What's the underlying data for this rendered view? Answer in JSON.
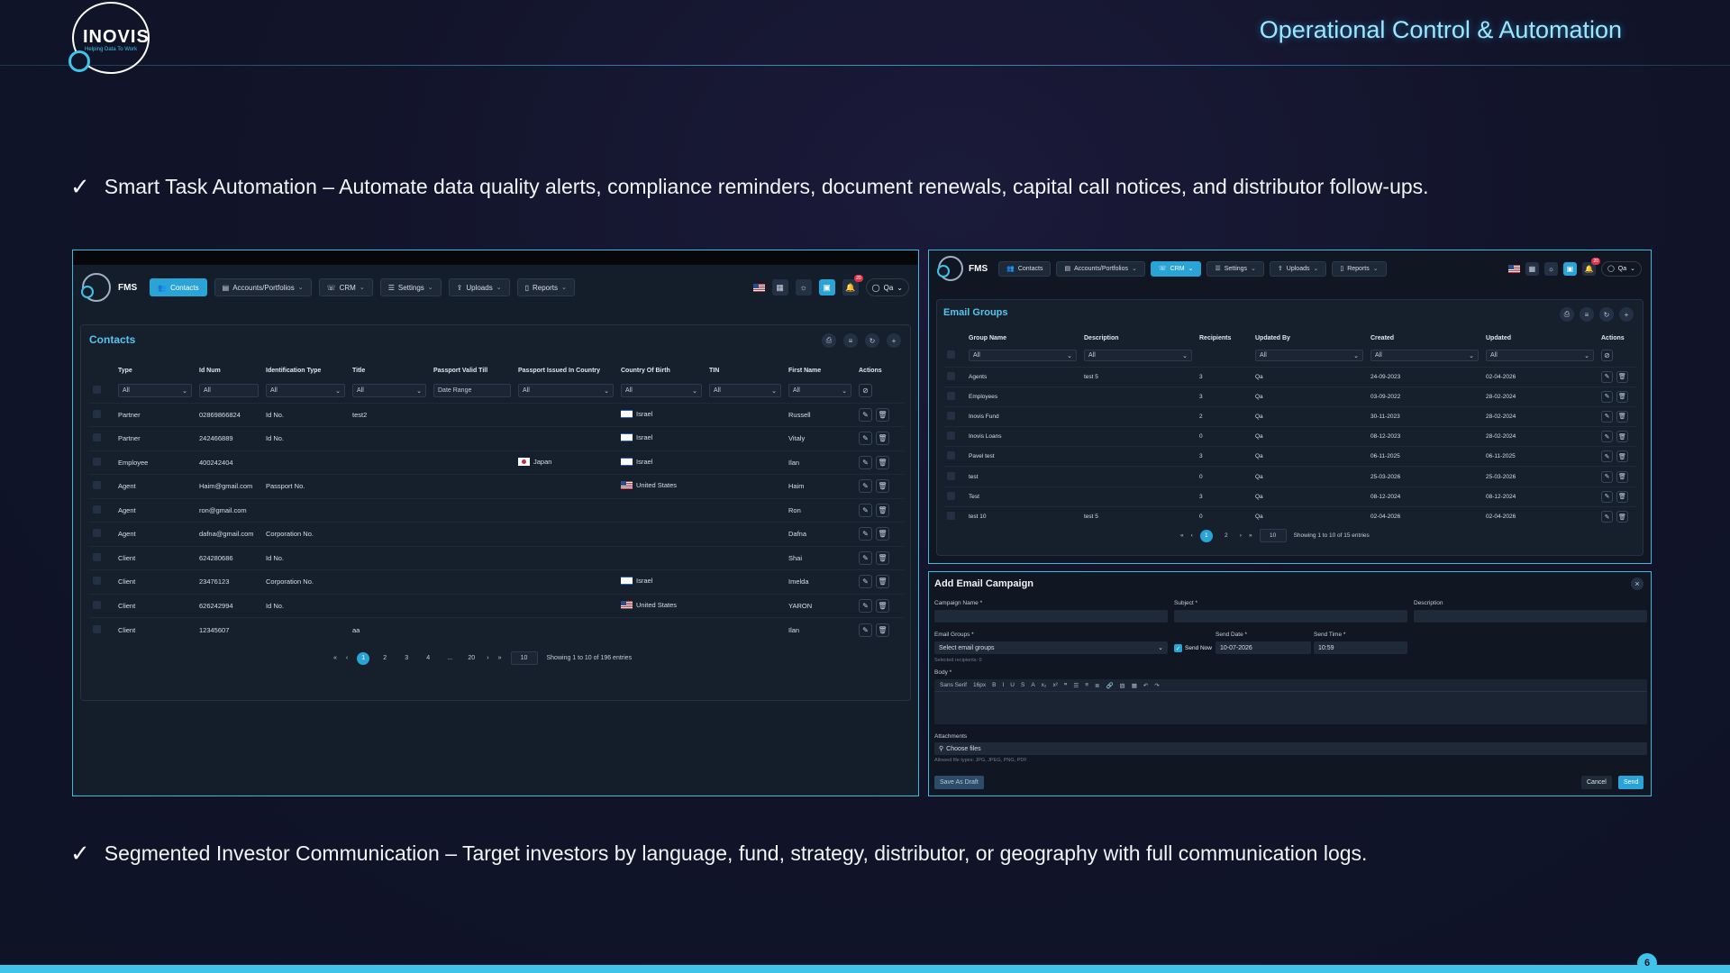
{
  "header": {
    "logo_text": "INOVIS",
    "logo_tagline": "Helping Data To Work",
    "title": "Operational Control & Automation"
  },
  "bullets": [
    "Smart Task Automation – Automate data quality alerts, compliance reminders, document renewals, capital call notices, and distributor follow-ups.",
    "Segmented Investor Communication – Target investors by language, fund, strategy, distributor, or geography with full communication logs."
  ],
  "page_number": "6",
  "nav": {
    "app": "FMS",
    "contacts": "Contacts",
    "accounts": "Accounts/Portfolios",
    "crm": "CRM",
    "settings": "Settings",
    "uploads": "Uploads",
    "reports": "Reports",
    "user": "Qa",
    "notifications": "20"
  },
  "contacts": {
    "title": "Contacts",
    "columns": [
      "Type",
      "Id Num",
      "Identification Type",
      "Title",
      "Passport Valid Till",
      "Passport Issued In Country",
      "Country Of Birth",
      "TIN",
      "First Name",
      "Actions"
    ],
    "filters": [
      "All",
      "All",
      "All",
      "All",
      "Date Range",
      "All",
      "All",
      "All",
      "All"
    ],
    "rows": [
      {
        "type": "Partner",
        "id": "02869866824",
        "idtype": "Id No.",
        "title": "test2",
        "pcountry": "",
        "pflag": "",
        "birth": "Israel",
        "bflag": "il",
        "fname": "Russell"
      },
      {
        "type": "Partner",
        "id": "242466889",
        "idtype": "Id No.",
        "title": "",
        "pcountry": "",
        "pflag": "",
        "birth": "Israel",
        "bflag": "il",
        "fname": "Vitaly"
      },
      {
        "type": "Employee",
        "id": "400242404",
        "idtype": "",
        "title": "",
        "pcountry": "Japan",
        "pflag": "jp",
        "birth": "Israel",
        "bflag": "il",
        "fname": "Ilan"
      },
      {
        "type": "Agent",
        "id": "Haim@gmail.com",
        "idtype": "Passport No.",
        "title": "",
        "pcountry": "",
        "pflag": "",
        "birth": "United States",
        "bflag": "us",
        "fname": "Haim"
      },
      {
        "type": "Agent",
        "id": "ron@gmail.com",
        "idtype": "",
        "title": "",
        "pcountry": "",
        "pflag": "",
        "birth": "",
        "bflag": "",
        "fname": "Ron"
      },
      {
        "type": "Agent",
        "id": "dafna@gmail.com",
        "idtype": "Corporation No.",
        "title": "",
        "pcountry": "",
        "pflag": "",
        "birth": "",
        "bflag": "",
        "fname": "Dafna"
      },
      {
        "type": "Client",
        "id": "624280686",
        "idtype": "Id No.",
        "title": "",
        "pcountry": "",
        "pflag": "",
        "birth": "",
        "bflag": "",
        "fname": "Shai"
      },
      {
        "type": "Client",
        "id": "23476123",
        "idtype": "Corporation No.",
        "title": "",
        "pcountry": "",
        "pflag": "",
        "birth": "Israel",
        "bflag": "il",
        "fname": "Imelda"
      },
      {
        "type": "Client",
        "id": "626242994",
        "idtype": "Id No.",
        "title": "",
        "pcountry": "",
        "pflag": "",
        "birth": "United States",
        "bflag": "us",
        "fname": "YARON"
      },
      {
        "type": "Client",
        "id": "12345607",
        "idtype": "",
        "title": "aa",
        "pcountry": "",
        "pflag": "",
        "birth": "",
        "bflag": "",
        "fname": "Ilan"
      }
    ],
    "pages": [
      "1",
      "2",
      "3",
      "4",
      "...",
      "20"
    ],
    "page_size": "10",
    "summary": "Showing 1 to 10 of 196 entries"
  },
  "email_groups": {
    "title": "Email Groups",
    "columns": [
      "Group Name",
      "Description",
      "Recipients",
      "Updated By",
      "Created",
      "Updated",
      "Actions"
    ],
    "filters": [
      "All",
      "All",
      "",
      "All",
      "All",
      "All"
    ],
    "rows": [
      {
        "name": "Agents",
        "desc": "test 5",
        "rec": "3",
        "by": "Qa",
        "created": "24-09-2023",
        "updated": "02-04-2026"
      },
      {
        "name": "Employees",
        "desc": "",
        "rec": "3",
        "by": "Qa",
        "created": "03-09-2022",
        "updated": "28-02-2024"
      },
      {
        "name": "Inovis Fund",
        "desc": "",
        "rec": "2",
        "by": "Qa",
        "created": "30-11-2023",
        "updated": "28-02-2024"
      },
      {
        "name": "Inovis Loans",
        "desc": "",
        "rec": "0",
        "by": "Qa",
        "created": "08-12-2023",
        "updated": "28-02-2024"
      },
      {
        "name": "Pavel test",
        "desc": "",
        "rec": "3",
        "by": "Qa",
        "created": "06-11-2025",
        "updated": "06-11-2025"
      },
      {
        "name": "test",
        "desc": "",
        "rec": "0",
        "by": "Qa",
        "created": "25-03-2026",
        "updated": "25-03-2026"
      },
      {
        "name": "Test",
        "desc": "",
        "rec": "3",
        "by": "Qa",
        "created": "08-12-2024",
        "updated": "08-12-2024"
      },
      {
        "name": "test 10",
        "desc": "test 5",
        "rec": "0",
        "by": "Qa",
        "created": "02-04-2026",
        "updated": "02-04-2026"
      }
    ],
    "pages": [
      "1",
      "2"
    ],
    "page_size": "10",
    "summary": "Showing 1 to 10 of 15 entries"
  },
  "campaign": {
    "title": "Add Email Campaign",
    "campaign_name_label": "Campaign Name *",
    "subject_label": "Subject *",
    "description_label": "Description",
    "groups_label": "Email Groups *",
    "groups_placeholder": "Select email groups",
    "send_now": "Send Now",
    "send_date_label": "Send Date *",
    "send_date": "10-07-2026",
    "send_time_label": "Send Time *",
    "send_time": "10:59",
    "selected_recipients": "Selected recipients: 0",
    "body_label": "Body *",
    "font": "Sans Serif",
    "font_size": "16px",
    "attachments_label": "Attachments",
    "choose_files": "Choose files",
    "allowed": "Allowed file types: JPG, JPEG, PNG, PDF",
    "save_draft": "Save As Draft",
    "cancel": "Cancel",
    "send": "Send"
  }
}
